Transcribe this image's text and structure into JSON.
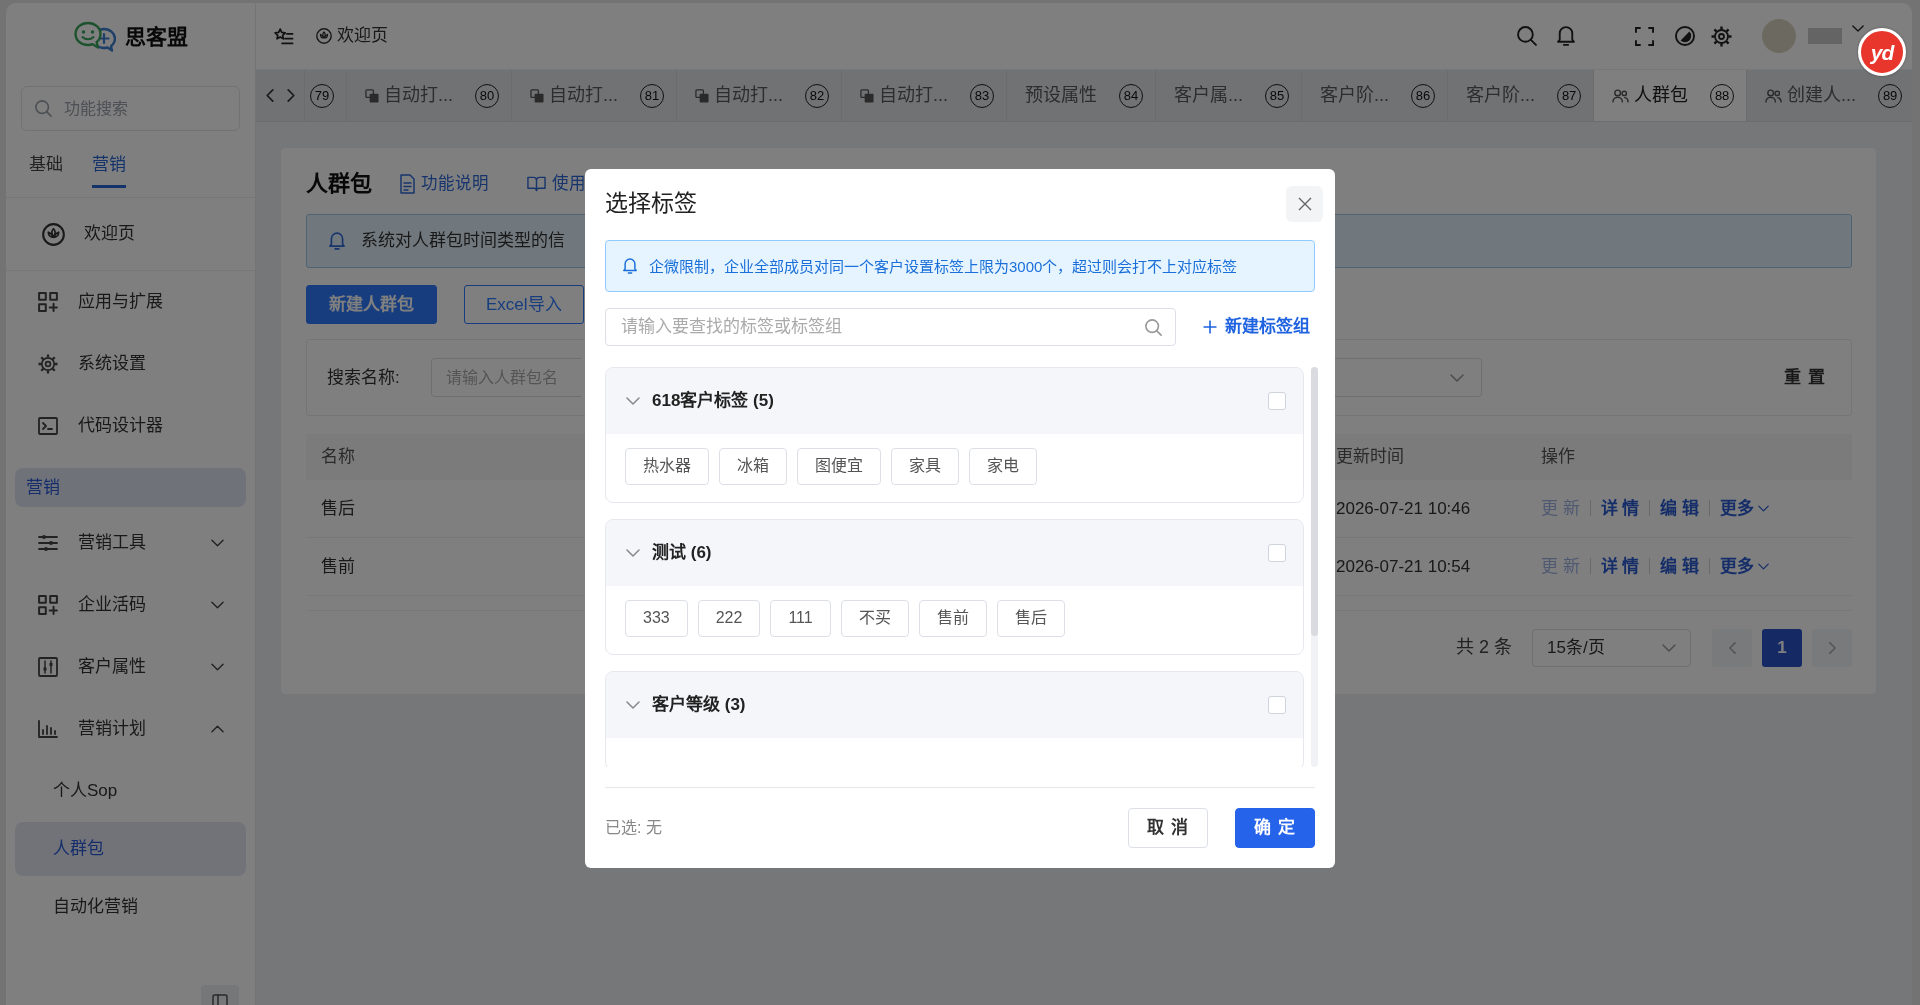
{
  "app": {
    "logo": "思客盟"
  },
  "sidebar": {
    "search": {
      "placeholder": "功能搜索"
    },
    "tabs": [
      {
        "label": "基础",
        "selected": false
      },
      {
        "label": "营销",
        "selected": true
      }
    ],
    "home": {
      "label": "欢迎页",
      "selected": false
    },
    "menu": [
      {
        "kind": "item",
        "label": "应用与扩展",
        "selected": false
      },
      {
        "kind": "item",
        "label": "系统设置",
        "selected": false
      },
      {
        "kind": "item",
        "label": "代码设计器",
        "selected": false
      },
      {
        "kind": "section",
        "label": "营销",
        "selected": true
      },
      {
        "kind": "group",
        "label": "营销工具",
        "selected": false,
        "expanded": false
      },
      {
        "kind": "group",
        "label": "企业活码",
        "selected": false,
        "expanded": false
      },
      {
        "kind": "group",
        "label": "客户属性",
        "selected": false,
        "expanded": false
      },
      {
        "kind": "group",
        "label": "营销计划",
        "selected": false,
        "expanded": true,
        "children": [
          {
            "label": "个人Sop",
            "selected": false
          },
          {
            "label": "人群包",
            "selected": true
          },
          {
            "label": "自动化营销",
            "selected": false
          }
        ]
      }
    ]
  },
  "header": {
    "breadcrumb": "欢迎页"
  },
  "tabs": [
    {
      "kind": "page",
      "hint": "79",
      "selected": false
    },
    {
      "kind": "automation",
      "label": "自动打...",
      "hint": "80",
      "selected": false
    },
    {
      "kind": "automation",
      "label": "自动打...",
      "hint": "81",
      "selected": false
    },
    {
      "kind": "automation",
      "label": "自动打...",
      "hint": "82",
      "selected": false
    },
    {
      "kind": "automation",
      "label": "自动打...",
      "hint": "83",
      "selected": false
    },
    {
      "kind": "page",
      "label": "预设属性",
      "hint": "84",
      "selected": false
    },
    {
      "kind": "page",
      "label": "客户属...",
      "hint": "85",
      "selected": false
    },
    {
      "kind": "page",
      "label": "客户阶...",
      "hint": "86",
      "selected": false
    },
    {
      "kind": "page",
      "label": "客户阶...",
      "hint": "87",
      "selected": false
    },
    {
      "kind": "audience",
      "label": "人群包",
      "hint": "88",
      "selected": true
    },
    {
      "kind": "audience",
      "label": "创建人...",
      "hint": "89",
      "selected": false
    }
  ],
  "page": {
    "title": "人群包",
    "links": [
      {
        "label": "功能说明"
      },
      {
        "label": "使用"
      }
    ],
    "alert": "系统对人群包时间类型的信",
    "buttons": [
      {
        "kind": "primary",
        "label": "新建人群包"
      },
      {
        "kind": "outline",
        "label": "Excel导入"
      }
    ],
    "filter": {
      "label": "搜索名称:",
      "placeholder": "请输入人群包名",
      "reset": "重 置"
    },
    "table": {
      "columns": [
        "名称",
        "更新时间",
        "操作"
      ],
      "rows": [
        {
          "name": "售后",
          "updated": "2026-07-21 10:46",
          "actions": [
            {
              "label": "更 新",
              "disabled": true
            },
            {
              "label": "详 情",
              "disabled": false
            },
            {
              "label": "编 辑",
              "disabled": false
            }
          ],
          "more": "更多"
        },
        {
          "name": "售前",
          "updated": "2026-07-21 10:54",
          "actions": [
            {
              "label": "更 新",
              "disabled": true
            },
            {
              "label": "详 情",
              "disabled": false
            },
            {
              "label": "编 辑",
              "disabled": false
            }
          ],
          "more": "更多"
        }
      ]
    },
    "pagination": {
      "total": "共 2 条",
      "page_size": "15条/页",
      "pages": [
        {
          "label": "1",
          "selected": true
        }
      ]
    }
  },
  "modal": {
    "title": "选择标签",
    "notice": "企微限制，企业全部成员对同一个客户设置标签上限为3000个，超过则会打不上对应标签",
    "search": {
      "placeholder": "请输入要查找的标签或标签组"
    },
    "new_group": "新建标签组",
    "groups": [
      {
        "title": "618客户标签 (5)",
        "expanded": true,
        "checked": false,
        "tags": [
          {
            "label": "热水器",
            "selected": false
          },
          {
            "label": "冰箱",
            "selected": false
          },
          {
            "label": "图便宜",
            "selected": false
          },
          {
            "label": "家具",
            "selected": false
          },
          {
            "label": "家电",
            "selected": false
          }
        ]
      },
      {
        "title": "测试 (6)",
        "expanded": true,
        "checked": false,
        "tags": [
          {
            "label": "333",
            "selected": false
          },
          {
            "label": "222",
            "selected": false
          },
          {
            "label": "111",
            "selected": false
          },
          {
            "label": "不买",
            "selected": false
          },
          {
            "label": "售前",
            "selected": false
          },
          {
            "label": "售后",
            "selected": false
          }
        ]
      },
      {
        "title": "客户等级 (3)",
        "expanded": true,
        "checked": false
      }
    ],
    "selected_text": "已选: 无",
    "buttons": [
      {
        "kind": "secondary",
        "label": "取 消"
      },
      {
        "kind": "primary",
        "label": "确 定"
      }
    ]
  },
  "floating_button": {
    "label": "yd"
  }
}
